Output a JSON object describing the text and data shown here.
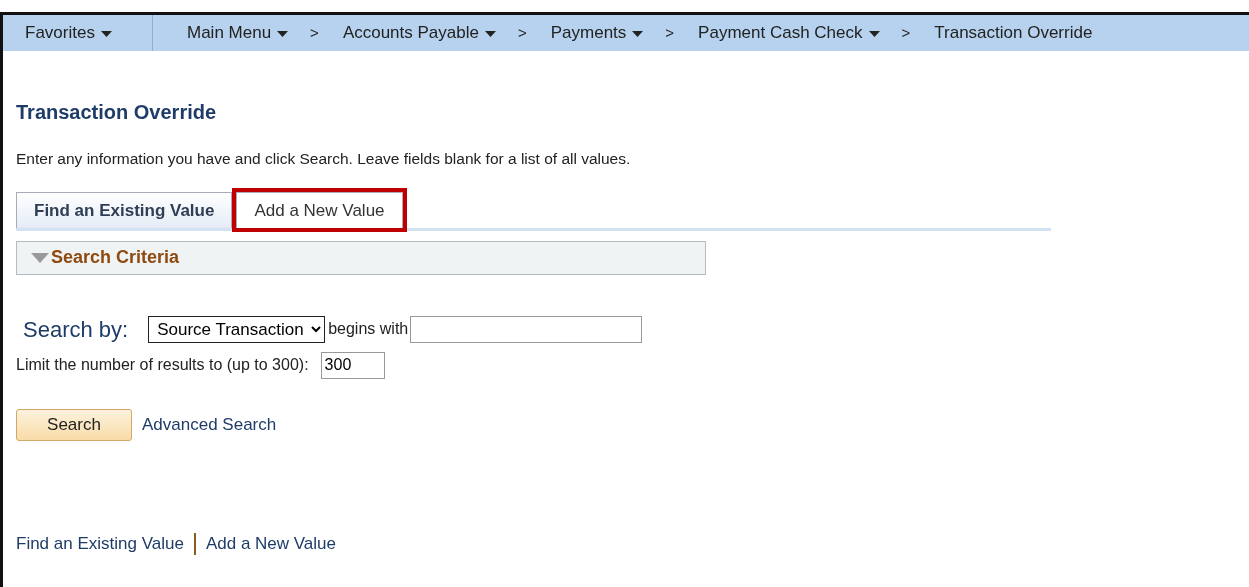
{
  "nav": {
    "favorites": {
      "label": "Favorites",
      "dropdown": true
    },
    "crumbs": [
      {
        "label": "Main Menu",
        "dropdown": true
      },
      {
        "label": "Accounts Payable",
        "dropdown": true
      },
      {
        "label": "Payments",
        "dropdown": true
      },
      {
        "label": "Payment Cash Check",
        "dropdown": true
      },
      {
        "label": "Transaction Override",
        "dropdown": false
      }
    ],
    "separator": ">"
  },
  "page_title": "Transaction Override",
  "instructions": "Enter any information you have and click Search. Leave fields blank for a list of all values.",
  "tabs": [
    {
      "label": "Find an Existing Value",
      "selected": true,
      "highlighted": false
    },
    {
      "label": "Add a New Value",
      "selected": false,
      "highlighted": true
    }
  ],
  "section": {
    "title": "Search Criteria",
    "expanded": true
  },
  "search_by": {
    "label": "Search by:",
    "value": "Source Transaction",
    "operator": "begins with"
  },
  "limit": {
    "label": "Limit the number of results to (up to 300):",
    "value": "300"
  },
  "buttons": {
    "search": "Search",
    "advanced": "Advanced Search"
  },
  "footer_links": [
    "Find an Existing Value",
    "Add a New Value"
  ]
}
